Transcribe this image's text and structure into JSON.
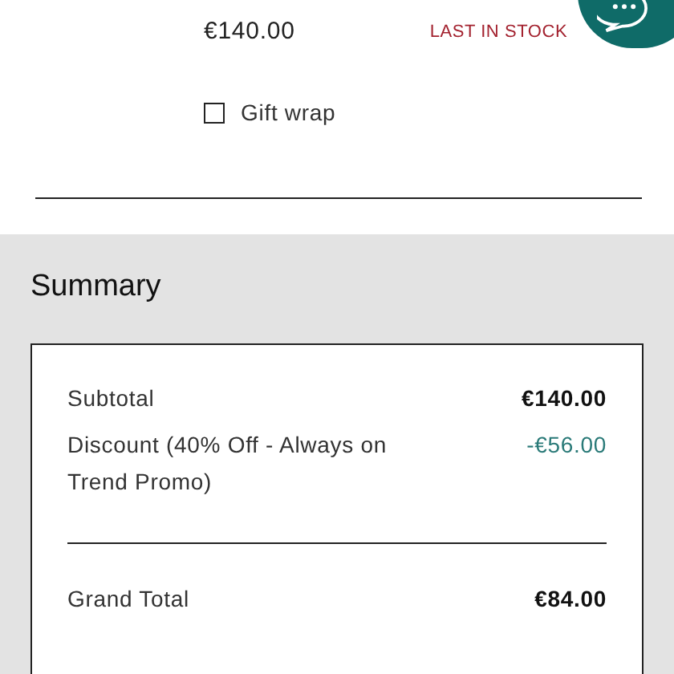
{
  "product": {
    "price": "€140.00",
    "stock_badge": "LAST IN STOCK",
    "gift_wrap": {
      "label": "Gift wrap",
      "checked": false
    }
  },
  "summary": {
    "title": "Summary",
    "rows": [
      {
        "label": "Subtotal",
        "value": "€140.00",
        "kind": "normal"
      },
      {
        "label": "Discount (40% Off - Always on Trend Promo)",
        "value": "-€56.00",
        "kind": "discount"
      }
    ],
    "grand_total": {
      "label": "Grand Total",
      "value": "€84.00"
    }
  }
}
